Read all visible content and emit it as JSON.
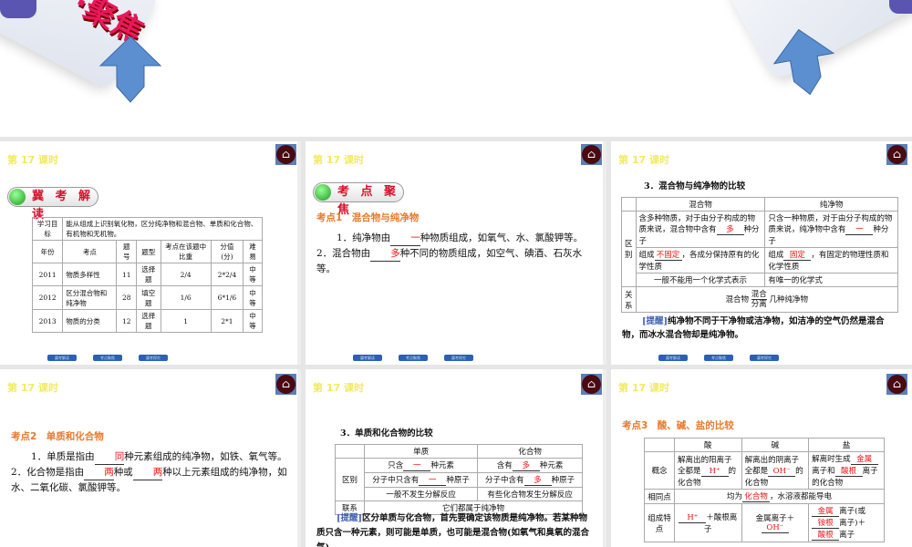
{
  "banner": {
    "slogan": "·聚焦"
  },
  "lesson": "第 17 课时",
  "nav_buttons": [
    "冀考解读",
    "考点聚焦",
    "冀考探究"
  ],
  "p1": {
    "badge": "冀 考 解 读",
    "goal_label": "学习目标",
    "goal": "能从组成上识别氧化物，区分纯净物和混合物、单质和化合物、有机物和无机物。",
    "headers": [
      "年份",
      "考点",
      "题号",
      "题型",
      "考点在该题中比重",
      "分值(分)",
      "难易"
    ],
    "rows": [
      [
        "2011",
        "物质多样性",
        "11",
        "选择题",
        "2/4",
        "2*2/4",
        "中等"
      ],
      [
        "2012",
        "区分混合物和纯净物",
        "28",
        "填空题",
        "1/6",
        "6*1/6",
        "中等"
      ],
      [
        "2013",
        "物质的分类",
        "12",
        "选择题",
        "1",
        "2*1",
        "中等"
      ]
    ]
  },
  "p2": {
    "badge": "考 点 聚 焦",
    "title": "考点1　混合物与纯净物",
    "l1a": "1．纯净物由",
    "l1b": "一",
    "l1c": "种物质组成，如氧气、水、氯酸钾等。",
    "l2a": "2．混合物由",
    "l2b": "多",
    "l2c": "种不同的物质组成，如空气、碘酒、石灰水等。"
  },
  "p3": {
    "title": "3．混合物与纯净物的比较",
    "h1": "混合物",
    "h2": "纯净物",
    "diff": "区别",
    "rel": "关系",
    "r1a": "含多种物质，对于由分子构成的物质来说，混合物中含有",
    "r1b": "多",
    "r1c": "种分子",
    "r1d": "只含一种物质，对于由分子构成的物质来说，纯净物中含有",
    "r1e": "一",
    "r1f": "种分子",
    "r2a": "组成",
    "r2b": "不固定",
    "r2c": "，各成分保持原有的化学性质",
    "r2d": "组成",
    "r2e": "固定",
    "r2f": "，有固定的物理性质和化学性质",
    "r3a": "一般不能用一个化学式表示",
    "r3b": "有唯一的化学式",
    "relA": "混合物",
    "relUp": "混合",
    "relDown": "分离",
    "relB": "几种纯净物",
    "tip_label": "[提醒]",
    "tip": "纯净物不同于干净物或洁净物，如洁净的空气仍然是混合物，而冰水混合物却是纯净物。"
  },
  "p4": {
    "title": "考点2　单质和化合物",
    "l1a": "1．单质是指由",
    "l1b": "同",
    "l1c": "种元素组成的纯净物，如铁、氧气等。",
    "l2a": "2．化合物是指由",
    "l2b": "两",
    "l2c": "种或",
    "l2d": "两",
    "l2e": "种以上元素组成的纯净物，如水、二氧化碳、氯酸钾等。"
  },
  "p5": {
    "title": "3．单质和化合物的比较",
    "h1": "单质",
    "h2": "化合物",
    "diff": "区别",
    "rel": "联系",
    "a1": "只含",
    "a1b": "一",
    "a1c": "种元素",
    "b1": "含有",
    "b1b": "多",
    "b1c": "种元素",
    "a2": "分子中只含有",
    "a2b": "一",
    "a2c": "种原子",
    "b2": "分子中含有",
    "b2b": "多",
    "b2c": "种原子",
    "a3": "一般不发生分解反应",
    "b3": "有些化合物发生分解反应",
    "relv": "它们都属于纯净物",
    "tip_label": "[提醒]",
    "tip": "区分单质与化合物，首先要确定该物质是纯净物。若某种物质只含一种元素，则可能是单质，也可能是混合物(如氧气和臭氧的混合气)。"
  },
  "p6": {
    "title": "考点3　酸、碱、盐的比较",
    "h": [
      "酸",
      "碱",
      "盐"
    ],
    "concept": "概念",
    "same": "相同点",
    "comp": "组成特点",
    "c1a": "解离出的阳离子全都是",
    "c1b": "H⁺",
    "c1c": "的化合物",
    "c2a": "解离出的阴离子全都是",
    "c2b": "OH⁻",
    "c2c": "的化合物",
    "c3a": "解离时生成",
    "c3b": "金属",
    "c3c": "离子和",
    "c3d": "酸根",
    "c3e": "离子的化合物",
    "s1": "均为",
    "s2": "化合物",
    "s3": "，水溶液都能导电",
    "k1a": "H⁺",
    "k1b": "＋酸根离子",
    "k2a": "金属离子＋",
    "k2b": "OH⁻",
    "k3a": "金属",
    "k3b": "离子(或",
    "k3c": "铵根",
    "k3d": "离子)＋",
    "k3e": "酸根",
    "k3f": "离子"
  }
}
